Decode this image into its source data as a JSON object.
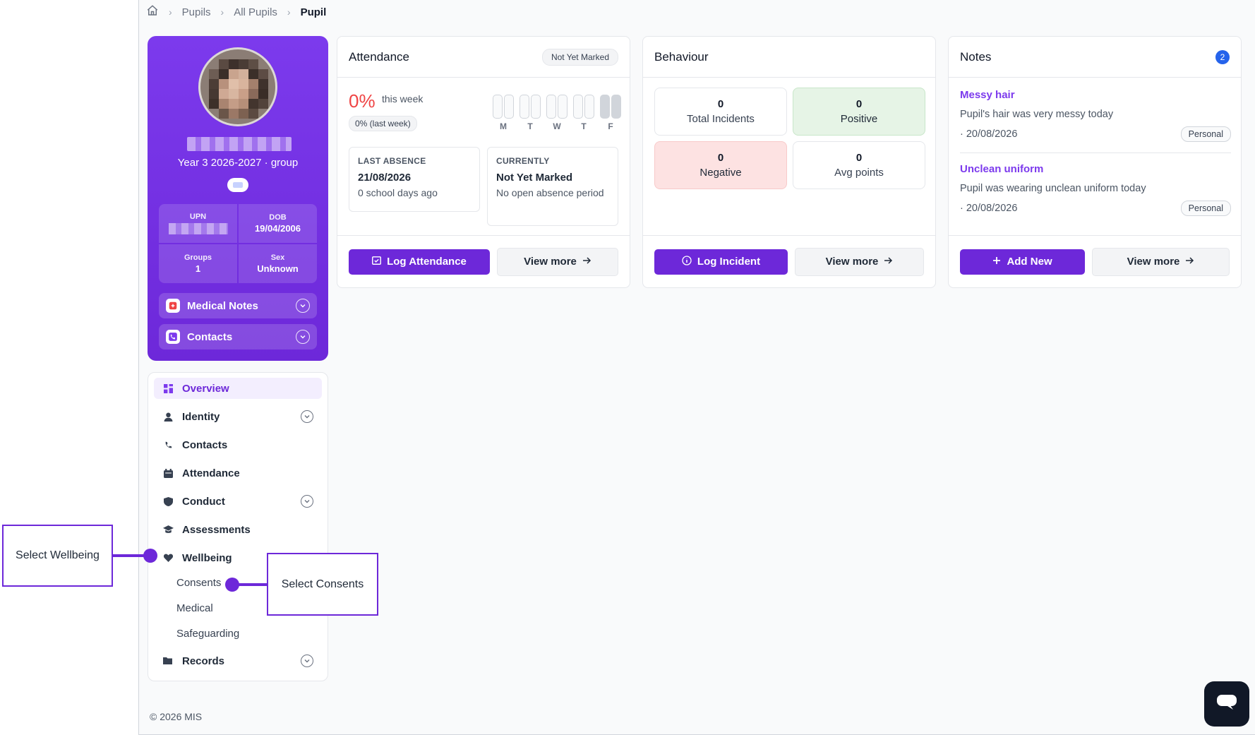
{
  "breadcrumb": {
    "items": [
      "Pupils",
      "All Pupils"
    ],
    "current": "Pupil"
  },
  "profile": {
    "group_line": "Year 3 2026-2027 · group",
    "stats": [
      {
        "label": "UPN",
        "value": ""
      },
      {
        "label": "DOB",
        "value": "19/04/2006"
      },
      {
        "label": "Groups",
        "value": "1"
      },
      {
        "label": "Sex",
        "value": "Unknown"
      }
    ],
    "medical_notes_label": "Medical Notes",
    "contacts_label": "Contacts"
  },
  "sidebar": {
    "items": [
      {
        "label": "Overview",
        "icon": "grid-icon",
        "active": true
      },
      {
        "label": "Identity",
        "icon": "user-icon",
        "expandable": true
      },
      {
        "label": "Contacts",
        "icon": "phone-icon"
      },
      {
        "label": "Attendance",
        "icon": "calendar-icon"
      },
      {
        "label": "Conduct",
        "icon": "shield-icon",
        "expandable": true
      },
      {
        "label": "Assessments",
        "icon": "graduation-cap-icon"
      },
      {
        "label": "Wellbeing",
        "icon": "heart-icon"
      },
      {
        "label": "Records",
        "icon": "folder-icon",
        "expandable": true
      }
    ],
    "wellbeing_sub": [
      "Consents",
      "Medical",
      "Safeguarding"
    ]
  },
  "attendance": {
    "title": "Attendance",
    "status_chip": "Not Yet Marked",
    "percent": "0%",
    "percent_suffix": "this week",
    "last_week": "0% (last week)",
    "days": [
      "M",
      "T",
      "W",
      "T",
      "F"
    ],
    "last_absence": {
      "heading": "LAST ABSENCE",
      "value": "21/08/2026",
      "sub": "0 school days ago"
    },
    "currently": {
      "heading": "CURRENTLY",
      "value": "Not Yet Marked",
      "sub": "No open absence period"
    },
    "log_button": "Log Attendance",
    "view_more": "View more"
  },
  "behaviour": {
    "title": "Behaviour",
    "cells": [
      {
        "value": "0",
        "label": "Total Incidents"
      },
      {
        "value": "0",
        "label": "Positive"
      },
      {
        "value": "0",
        "label": "Negative"
      },
      {
        "value": "0",
        "label": "Avg points"
      }
    ],
    "log_button": "Log Incident",
    "view_more": "View more"
  },
  "notes": {
    "title": "Notes",
    "count": "2",
    "items": [
      {
        "title": "Messy hair",
        "desc": "Pupil's hair was very messy today",
        "date": "· 20/08/2026",
        "tag": "Personal"
      },
      {
        "title": "Unclean uniform",
        "desc": "Pupil was wearing unclean uniform today",
        "date": "· 20/08/2026",
        "tag": "Personal"
      }
    ],
    "add_button": "Add New",
    "view_more": "View more"
  },
  "footer": "© 2026 MIS",
  "annotations": {
    "wellbeing": "Select Wellbeing",
    "consents": "Select Consents"
  },
  "colors": {
    "accent": "#6d28d9",
    "danger": "#ef4444",
    "positive_bg": "#e6f4e6",
    "negative_bg": "#fde2e2"
  }
}
